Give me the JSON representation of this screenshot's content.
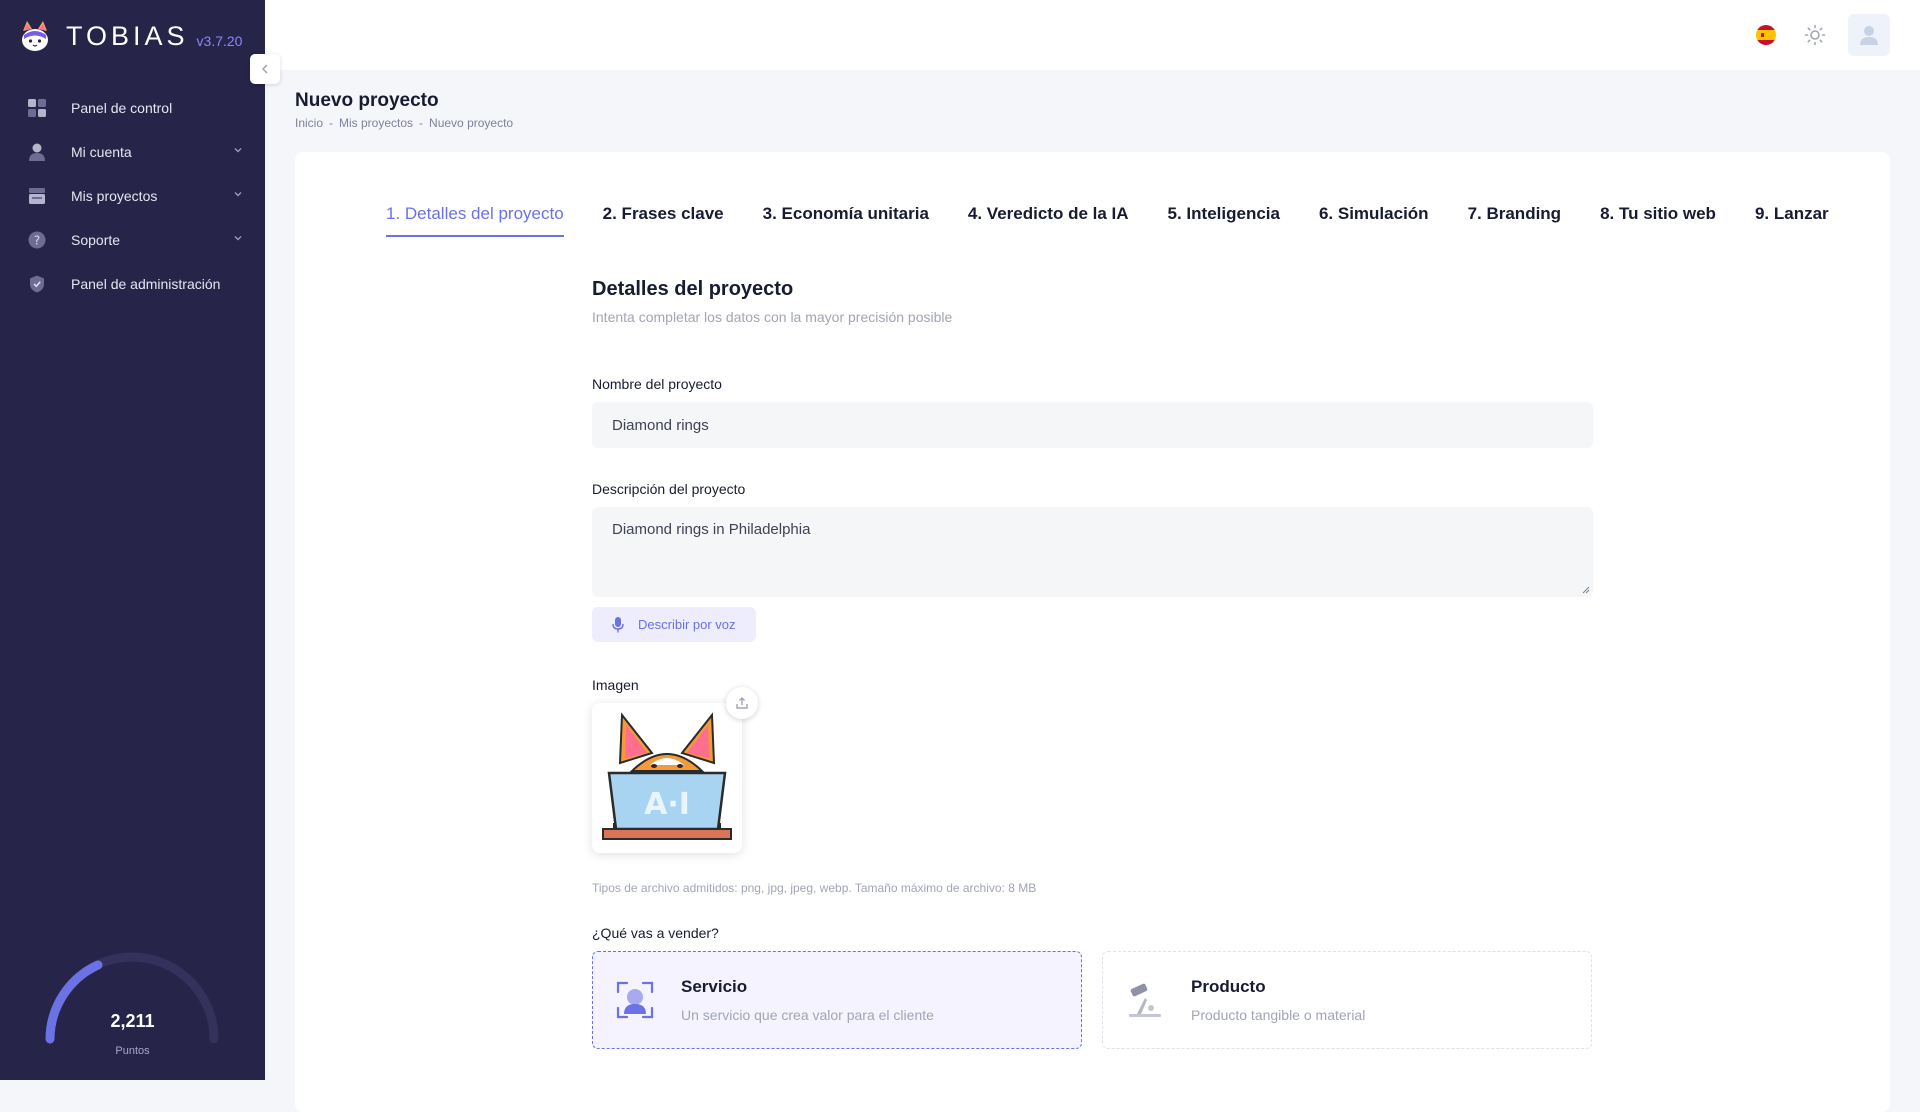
{
  "app": {
    "name": "TOBIAS",
    "version": "v3.7.20"
  },
  "sidebar": {
    "items": [
      {
        "label": "Panel de control",
        "icon": "dashboard-icon"
      },
      {
        "label": "Mi cuenta",
        "icon": "user-icon",
        "expandable": true
      },
      {
        "label": "Mis proyectos",
        "icon": "projects-icon",
        "expandable": true
      },
      {
        "label": "Soporte",
        "icon": "help-icon",
        "expandable": true
      },
      {
        "label": "Panel de administración",
        "icon": "shield-icon"
      }
    ],
    "points": {
      "value": "2,211",
      "label": "Puntos"
    }
  },
  "header": {
    "language": "es",
    "theme_icon": "sun-icon",
    "avatar_icon": "user-avatar-icon"
  },
  "page": {
    "title": "Nuevo proyecto",
    "breadcrumb": [
      "Inicio",
      "Mis proyectos",
      "Nuevo proyecto"
    ],
    "breadcrumb_separator": "-"
  },
  "steps": [
    "1. Detalles del proyecto",
    "2. Frases clave",
    "3. Economía unitaria",
    "4. Veredicto de la IA",
    "5. Inteligencia",
    "6. Simulación",
    "7. Branding",
    "8. Tu sitio web",
    "9. Lanzar"
  ],
  "form": {
    "title": "Detalles del proyecto",
    "subtitle": "Intenta completar los datos con la mayor precisión posible",
    "name_label": "Nombre del proyecto",
    "name_value": "Diamond rings",
    "description_label": "Descripción del proyecto",
    "description_value": "Diamond rings in Philadelphia",
    "voice_button": "Describir por voz",
    "image_label": "Imagen",
    "image_hint": "Tipos de archivo admitidos: png, jpg, jpeg, webp. Tamaño máximo de archivo: 8 MB",
    "sell_label": "¿Qué vas a vender?",
    "options": [
      {
        "title": "Servicio",
        "desc": "Un servicio que crea valor para el cliente",
        "selected": true
      },
      {
        "title": "Producto",
        "desc": "Producto tangible o material",
        "selected": false
      }
    ]
  },
  "colors": {
    "sidebar": "#262448",
    "accent": "#6a72e6",
    "version": "#8b86ff"
  }
}
